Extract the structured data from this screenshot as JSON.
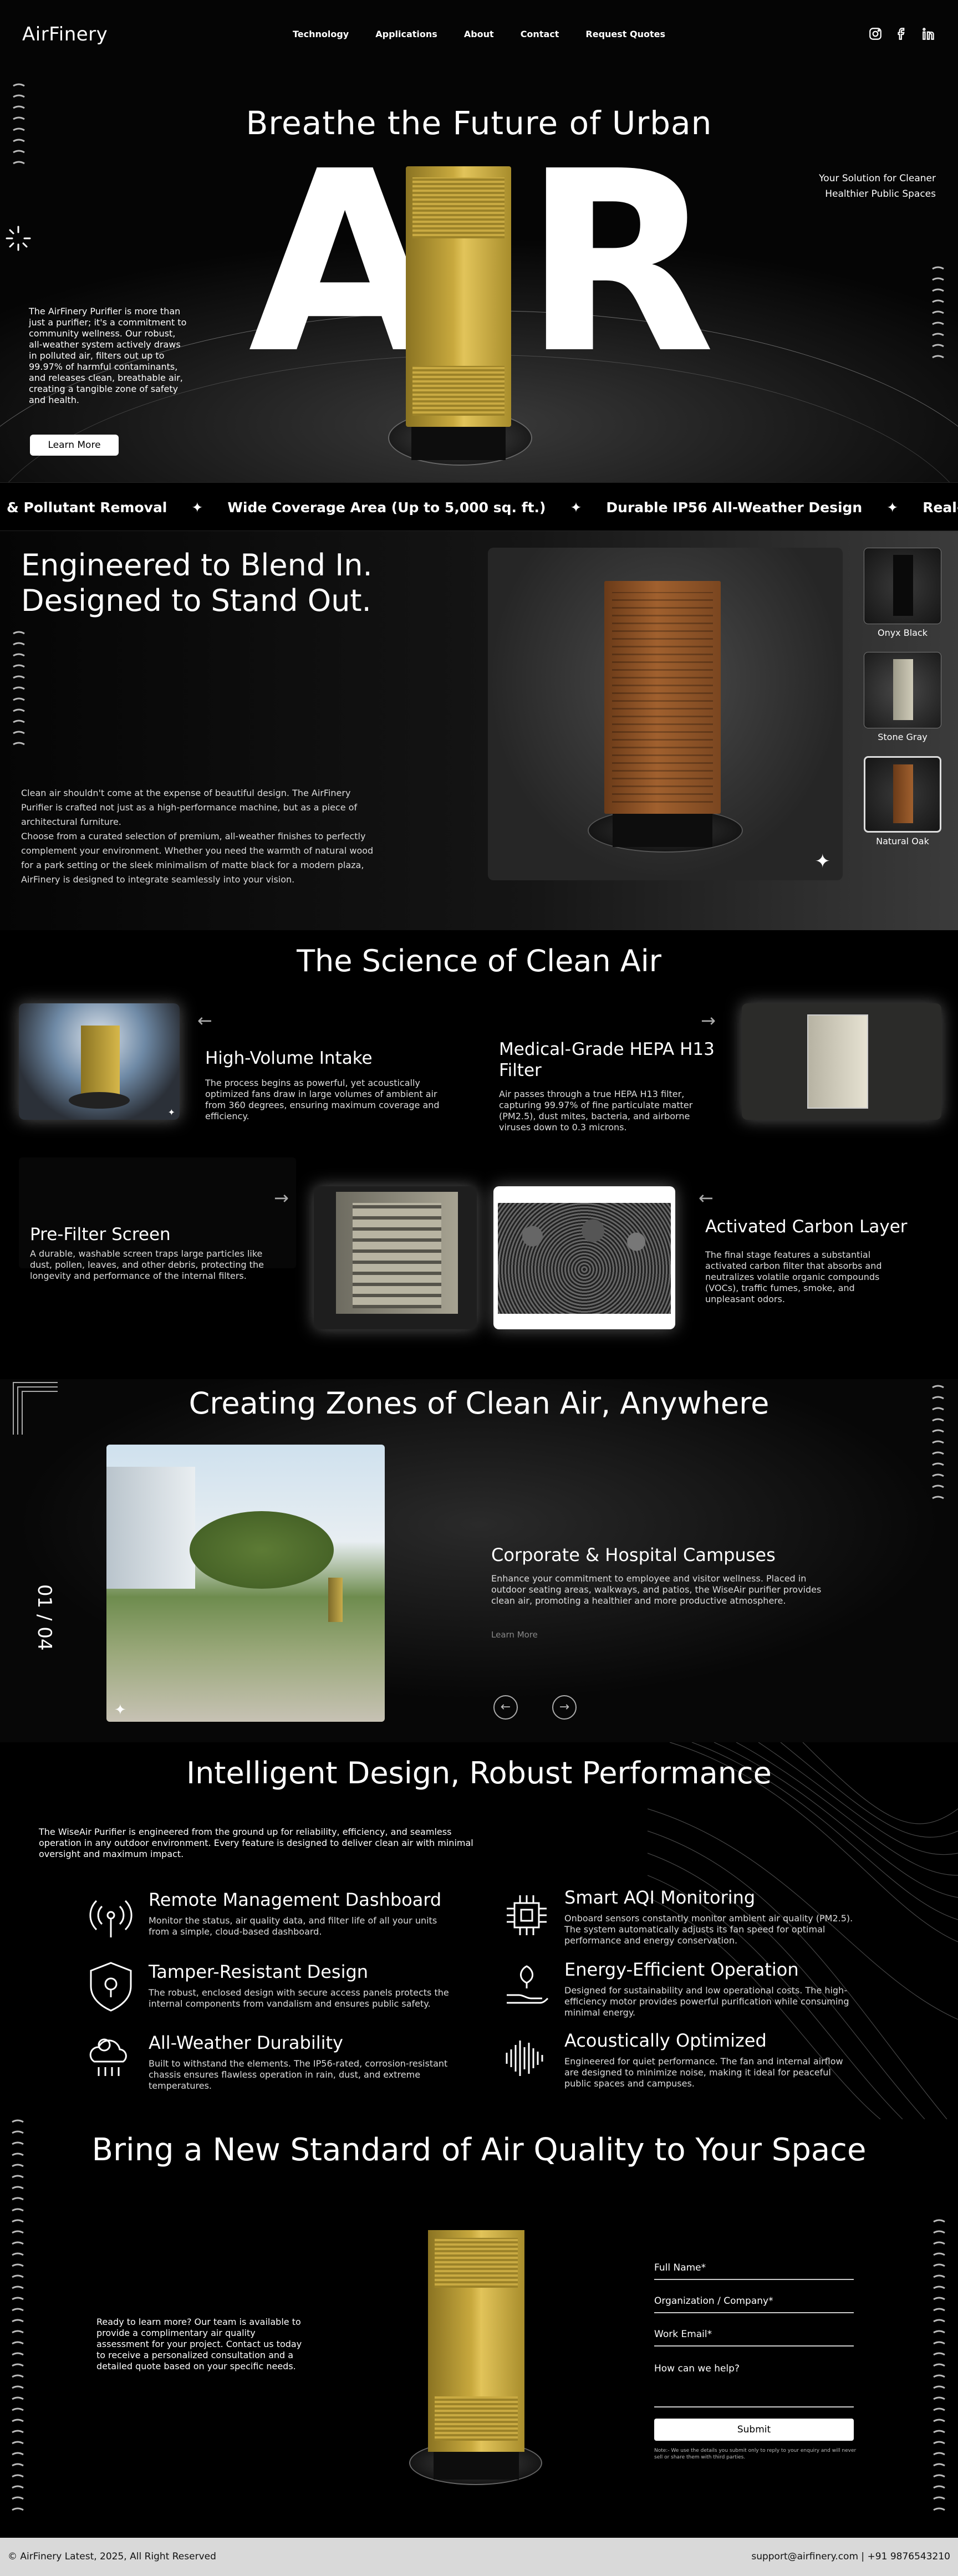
{
  "header": {
    "logo": "AirFinery",
    "nav": [
      "Technology",
      "Applications",
      "About",
      "Contact",
      "Request Quotes"
    ],
    "social": [
      "instagram-icon",
      "facebook-icon",
      "linkedin-icon"
    ]
  },
  "hero": {
    "title": "Breathe the Future of Urban",
    "big_word": "AIR",
    "tagline": "Your Solution for Cleaner Healthier Public Spaces",
    "intro": "The AirFinery Purifier is more than just a purifier; it's a commitment to community wellness. Our robust, all-weather system actively draws in polluted air, filters out up to 99.97% of harmful contaminants, and releases clean, breathable air, creating a tangible zone of safety and health.",
    "cta": "Learn More"
  },
  "ticker": {
    "items": [
      "& Pollutant Removal",
      "Wide Coverage Area (Up to 5,000 sq. ft.)",
      "Durable IP56 All-Weather Design",
      "Real-Time Smart Air Quality Monitoring"
    ]
  },
  "design": {
    "title_line1": "Engineered to Blend In.",
    "title_line2": "Designed to Stand Out.",
    "para1": "Clean air shouldn't come at the expense of beautiful design. The AirFinery Purifier is crafted not just as a high-performance machine, but as a piece of architectural furniture.",
    "para2": "Choose from a curated selection of premium, all-weather finishes to perfectly complement your environment. Whether you need the warmth of natural wood for a park setting or the sleek minimalism of matte black for a modern plaza, AirFinery is designed to integrate seamlessly into your vision.",
    "finishes": [
      "Onyx Black",
      "Stone Gray",
      "Natural Oak"
    ],
    "selected_finish": "Natural Oak"
  },
  "science": {
    "title": "The Science of Clean Air",
    "steps": [
      {
        "title": "High-Volume Intake",
        "text": "The process begins as powerful, yet acoustically optimized fans draw in large volumes of ambient air from 360 degrees, ensuring maximum coverage and efficiency."
      },
      {
        "title": "Medical-Grade HEPA H13 Filter",
        "text": "Air passes through a true HEPA H13 filter, capturing 99.97% of fine particulate matter (PM2.5), dust mites, bacteria, and airborne viruses down to 0.3 microns."
      },
      {
        "title": "Pre-Filter Screen",
        "text": "A durable, washable screen traps large particles like dust, pollen, leaves, and other debris, protecting the longevity and performance of the internal filters."
      },
      {
        "title": "Activated Carbon Layer",
        "text": "The final stage features a substantial activated carbon filter that absorbs and neutralizes volatile organic compounds (VOCs), traffic fumes, smoke, and unpleasant odors."
      }
    ]
  },
  "zones": {
    "title": "Creating Zones of Clean Air, Anywhere",
    "counter": "01 / 04",
    "item_title": "Corporate & Hospital Campuses",
    "item_text": "Enhance your commitment to employee and visitor wellness. Placed in outdoor seating areas, walkways, and patios, the WiseAir purifier provides clean air, promoting a healthier and more productive atmosphere.",
    "link": "Learn More"
  },
  "features": {
    "title": "Intelligent Design, Robust Performance",
    "intro": "The WiseAir Purifier is engineered from the ground up for reliability, efficiency, and seamless operation in any outdoor environment. Every feature is designed to deliver clean air with minimal oversight and maximum impact.",
    "items": [
      {
        "icon": "wireless-signal-icon",
        "title": "Remote Management Dashboard",
        "text": "Monitor the status, air quality data, and filter life of all your units from a simple, cloud-based dashboard."
      },
      {
        "icon": "chip-icon",
        "title": "Smart AQI Monitoring",
        "text": "Onboard sensors constantly monitor ambient air quality (PM2.5). The system automatically adjusts its fan speed for optimal performance and energy conservation."
      },
      {
        "icon": "shield-lock-icon",
        "title": "Tamper-Resistant Design",
        "text": "The robust, enclosed design with secure access panels protects the internal components from vandalism and ensures public safety."
      },
      {
        "icon": "leaf-hand-icon",
        "title": "Energy-Efficient Operation",
        "text": "Designed for sustainability and low operational costs. The high-efficiency motor provides powerful purification while consuming minimal energy."
      },
      {
        "icon": "weather-cloud-icon",
        "title": "All-Weather Durability",
        "text": "Built to withstand the elements. The IP56-rated, corrosion-resistant chassis ensures flawless operation in rain, dust, and extreme temperatures."
      },
      {
        "icon": "sound-wave-icon",
        "title": "Acoustically Optimized",
        "text": "Engineered for quiet performance. The fan and internal airflow are designed to minimize noise, making it ideal for peaceful public spaces and campuses."
      }
    ]
  },
  "contact": {
    "title": "Bring a New Standard of Air Quality to Your Space",
    "text": "Ready to learn more? Our team is available to provide a complimentary air quality assessment for your project. Contact us today to receive a personalized consultation and a detailed quote based on your specific needs.",
    "fields": [
      "Full Name*",
      "Organization / Company*",
      "Work Email*",
      "How can we help?"
    ],
    "submit": "Submit",
    "note": "Note:- We use the details you submit only to reply to your enquiry and will never sell or share them with third parties."
  },
  "footer": {
    "copyright": "© AirFinery Latest, 2025, All Right Reserved",
    "contact": "support@airfinery.com | +91 9876543210"
  }
}
